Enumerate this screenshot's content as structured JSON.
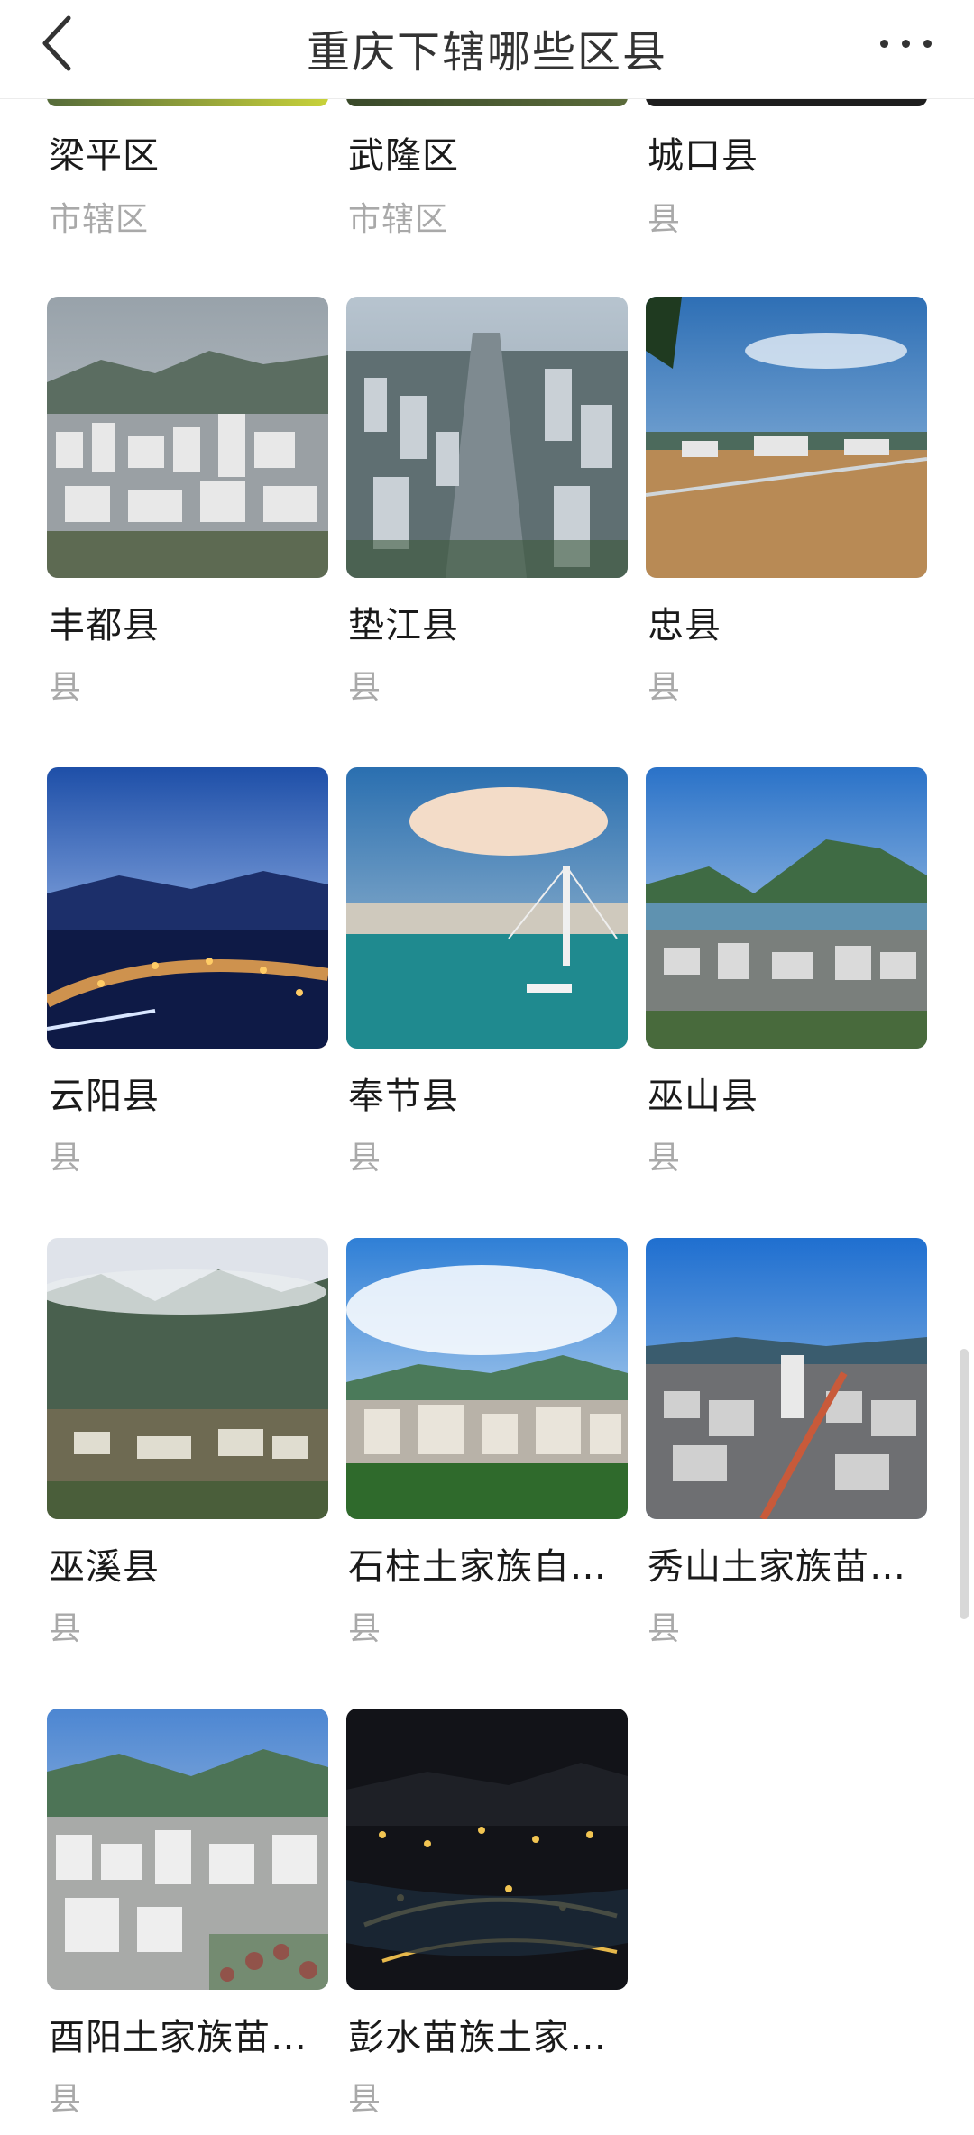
{
  "header": {
    "title": "重庆下辖哪些区县",
    "back_icon": "chevron-left-icon",
    "more_icon": "more-horizontal-icon"
  },
  "top_row": [
    {
      "name": "梁平区",
      "type": "市辖区"
    },
    {
      "name": "武隆区",
      "type": "市辖区"
    },
    {
      "name": "城口县",
      "type": "县"
    }
  ],
  "items": [
    {
      "name": "丰都县",
      "type": "县"
    },
    {
      "name": "垫江县",
      "type": "县"
    },
    {
      "name": "忠县",
      "type": "县"
    },
    {
      "name": "云阳县",
      "type": "县"
    },
    {
      "name": "奉节县",
      "type": "县"
    },
    {
      "name": "巫山县",
      "type": "县"
    },
    {
      "name": "巫溪县",
      "type": "县"
    },
    {
      "name": "石柱土家族自…",
      "type": "县"
    },
    {
      "name": "秀山土家族苗…",
      "type": "县"
    },
    {
      "name": "酉阳土家族苗…",
      "type": "县"
    },
    {
      "name": "彭水苗族土家…",
      "type": "县"
    }
  ]
}
